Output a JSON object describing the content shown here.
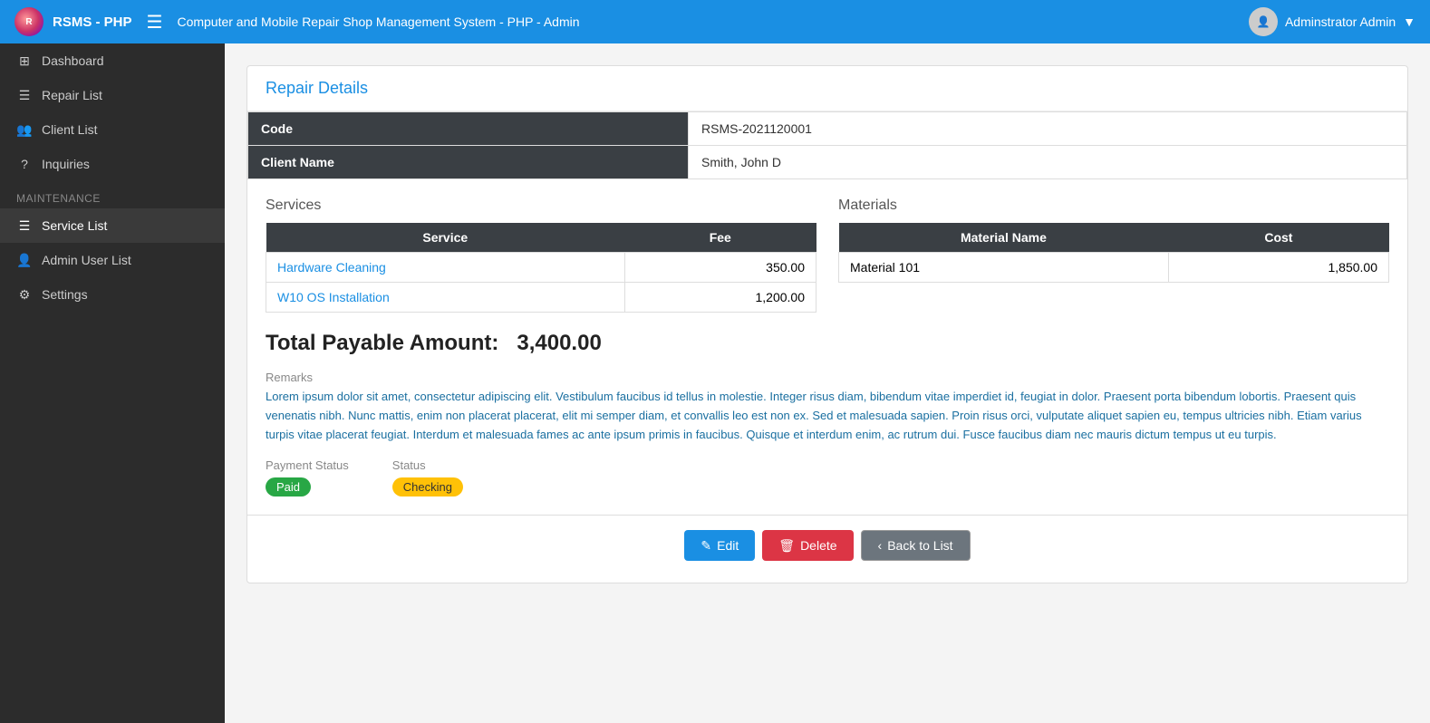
{
  "app": {
    "brand": "RSMS - PHP",
    "title": "Computer and Mobile Repair Shop Management System - PHP - Admin",
    "user": "Adminstrator Admin"
  },
  "sidebar": {
    "items": [
      {
        "id": "dashboard",
        "label": "Dashboard",
        "icon": "dashboard"
      },
      {
        "id": "repair-list",
        "label": "Repair List",
        "icon": "repair"
      },
      {
        "id": "client-list",
        "label": "Client List",
        "icon": "client"
      },
      {
        "id": "inquiries",
        "label": "Inquiries",
        "icon": "inquiry"
      }
    ],
    "maintenance_label": "Maintenance",
    "maintenance_items": [
      {
        "id": "service-list",
        "label": "Service List",
        "icon": "service"
      },
      {
        "id": "admin-user-list",
        "label": "Admin User List",
        "icon": "admin"
      },
      {
        "id": "settings",
        "label": "Settings",
        "icon": "settings"
      }
    ]
  },
  "page": {
    "section_title": "Repair Details",
    "code_label": "Code",
    "code_value": "RSMS-2021120001",
    "client_name_label": "Client Name",
    "client_name_value": "Smith, John D",
    "services_label": "Services",
    "materials_label": "Materials",
    "services_table": {
      "col_service": "Service",
      "col_fee": "Fee",
      "rows": [
        {
          "name": "Hardware Cleaning",
          "fee": "350.00"
        },
        {
          "name": "W10 OS Installation",
          "fee": "1,200.00"
        }
      ]
    },
    "materials_table": {
      "col_name": "Material Name",
      "col_cost": "Cost",
      "rows": [
        {
          "name": "Material 101",
          "cost": "1,850.00"
        }
      ]
    },
    "total_payable_label": "Total Payable Amount:",
    "total_payable_value": "3,400.00",
    "remarks_label": "Remarks",
    "remarks_text": "Lorem ipsum dolor sit amet, consectetur adipiscing elit. Vestibulum faucibus id tellus in molestie. Integer risus diam, bibendum vitae imperdiet id, feugiat in dolor. Praesent porta bibendum lobortis. Praesent quis venenatis nibh. Nunc mattis, enim non placerat placerat, elit mi semper diam, et convallis leo est non ex. Sed et malesuada sapien. Proin risus orci, vulputate aliquet sapien eu, tempus ultricies nibh. Etiam varius turpis vitae placerat feugiat. Interdum et malesuada fames ac ante ipsum primis in faucibus. Quisque et interdum enim, ac rutrum dui. Fusce faucibus diam nec mauris dictum tempus ut eu turpis.",
    "payment_status_label": "Payment Status",
    "payment_status_value": "Paid",
    "status_label": "Status",
    "status_value": "Checking",
    "btn_edit": "Edit",
    "btn_delete": "Delete",
    "btn_back": "Back to List"
  }
}
